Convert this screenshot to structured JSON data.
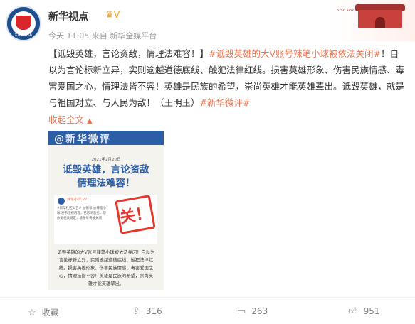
{
  "header": {
    "nickname": "新华视点",
    "verified_icon": "crown-v-badge-icon",
    "time": "今天 11:05",
    "source": "来自 新华全媒平台",
    "avatar_text": "XINHUA"
  },
  "post": {
    "segments": [
      {
        "text": "【诋毁英雄，言论资敌，情理法难容！】",
        "link": false
      },
      {
        "text": "#诋毁英雄的大V账号辣笔小球被依法关闭#",
        "link": true
      },
      {
        "text": "！自以为言论标新立异，实则逾越道德底线、触犯法律红线。损害英雄形象、伤害民族情感、毒害爱国之心，情理法皆不容！英雄是民族的希望，崇尚英雄才能英雄辈出。诋毁英雄，就是与祖国对立、与人民为敌！（王明玉）",
        "link": false
      },
      {
        "text": "#新华微评#",
        "link": true
      }
    ],
    "fold_label": "收起全文",
    "fold_icon": "chevron-up-icon"
  },
  "card": {
    "top_text": "@新华微评",
    "date": "2021年2月20日",
    "headline_line1": "诋毁英雄，言论资敌",
    "headline_line2": "情理法难容！",
    "inner_name": "辣笔小球 V2",
    "inner_text": "#新华社区公告# @账号 @辣笔小球 发布违规内容，已影响恶劣，现依据相关规定，该账号将被关闭",
    "stamp": "关！",
    "body": "诋毁英雄的大V账号辣笔小球被依法关闭！自以为言论标新立异，实则逾越道德底线、触犯法律红线。损害英雄形象、伤害民族情感、毒害爱国之心，情理法皆不容！英雄是民族的希望，崇尚英雄才能英雄辈出。"
  },
  "actions": {
    "favorite": {
      "label": "收藏",
      "icon": "star-icon"
    },
    "share": {
      "label": "316",
      "icon": "share-icon"
    },
    "comment": {
      "label": "263",
      "icon": "comment-icon"
    },
    "like": {
      "label": "951",
      "icon": "thumbs-up-icon"
    }
  },
  "colors": {
    "link": "#eb7350",
    "brand_blue": "#2c5ea8",
    "stamp_red": "#e6362d"
  }
}
